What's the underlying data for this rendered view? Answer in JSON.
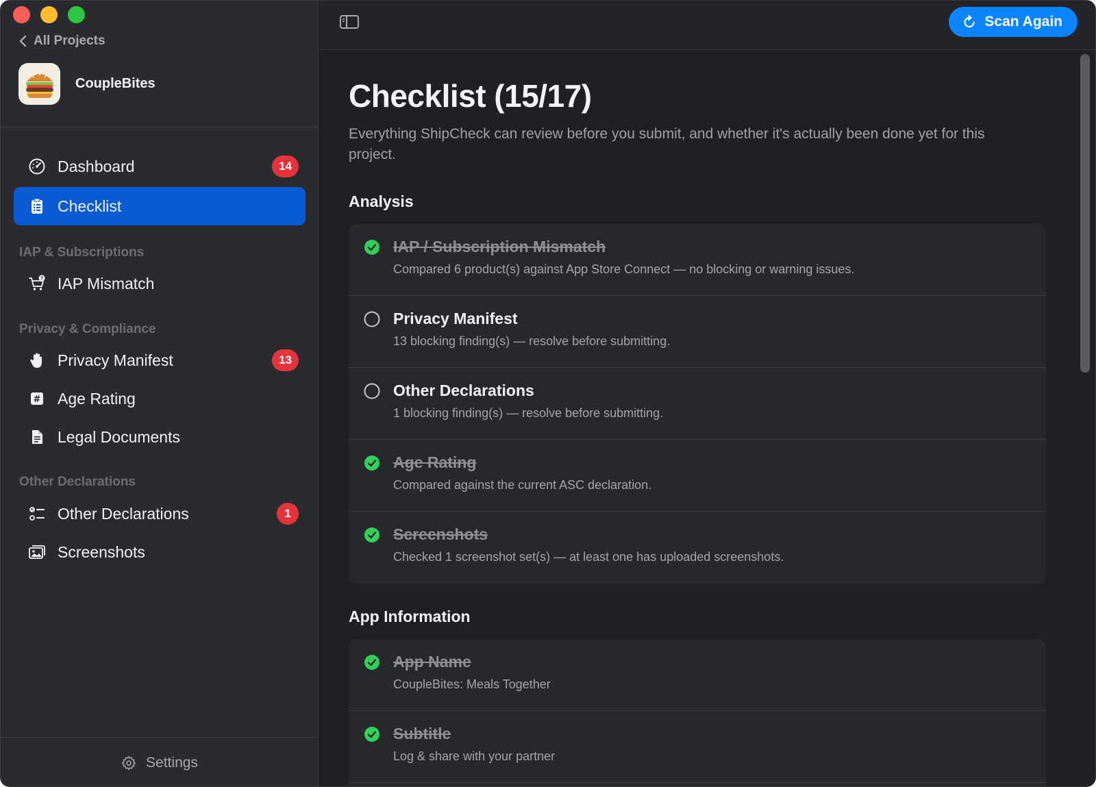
{
  "sidebar": {
    "back_label": "All Projects",
    "project_name": "CoupleBites",
    "items": [
      {
        "label": "Dashboard",
        "badge": "14"
      },
      {
        "label": "Checklist"
      },
      {
        "label": "IAP Mismatch"
      },
      {
        "label": "Privacy Manifest",
        "badge": "13"
      },
      {
        "label": "Age Rating"
      },
      {
        "label": "Legal Documents"
      },
      {
        "label": "Other Declarations",
        "badge": "1"
      },
      {
        "label": "Screenshots"
      }
    ],
    "sections": [
      "IAP & Subscriptions",
      "Privacy & Compliance",
      "Other Declarations"
    ],
    "settings_label": "Settings"
  },
  "toolbar": {
    "scan_label": "Scan Again"
  },
  "main": {
    "title": "Checklist (15/17)",
    "description": "Everything ShipCheck can review before you submit, and whether it's actually been done yet for this project.",
    "groups": [
      {
        "title": "Analysis",
        "rows": [
          {
            "title": "IAP / Subscription Mismatch",
            "subtitle": "Compared 6 product(s) against App Store Connect — no blocking or warning issues.",
            "done": true
          },
          {
            "title": "Privacy Manifest",
            "subtitle": "13 blocking finding(s) — resolve before submitting.",
            "done": false
          },
          {
            "title": "Other Declarations",
            "subtitle": "1 blocking finding(s) — resolve before submitting.",
            "done": false
          },
          {
            "title": "Age Rating",
            "subtitle": "Compared against the current ASC declaration.",
            "done": true
          },
          {
            "title": "Screenshots",
            "subtitle": "Checked 1 screenshot set(s) — at least one has uploaded screenshots.",
            "done": true
          }
        ]
      },
      {
        "title": "App Information",
        "rows": [
          {
            "title": "App Name",
            "subtitle": "CoupleBites: Meals Together",
            "done": true
          },
          {
            "title": "Subtitle",
            "subtitle": "Log & share with your partner",
            "done": true
          }
        ]
      }
    ]
  },
  "colors": {
    "accent": "#0a84ff",
    "active_nav": "#0a5bd3",
    "badge": "#e5333c",
    "success": "#30d158"
  }
}
